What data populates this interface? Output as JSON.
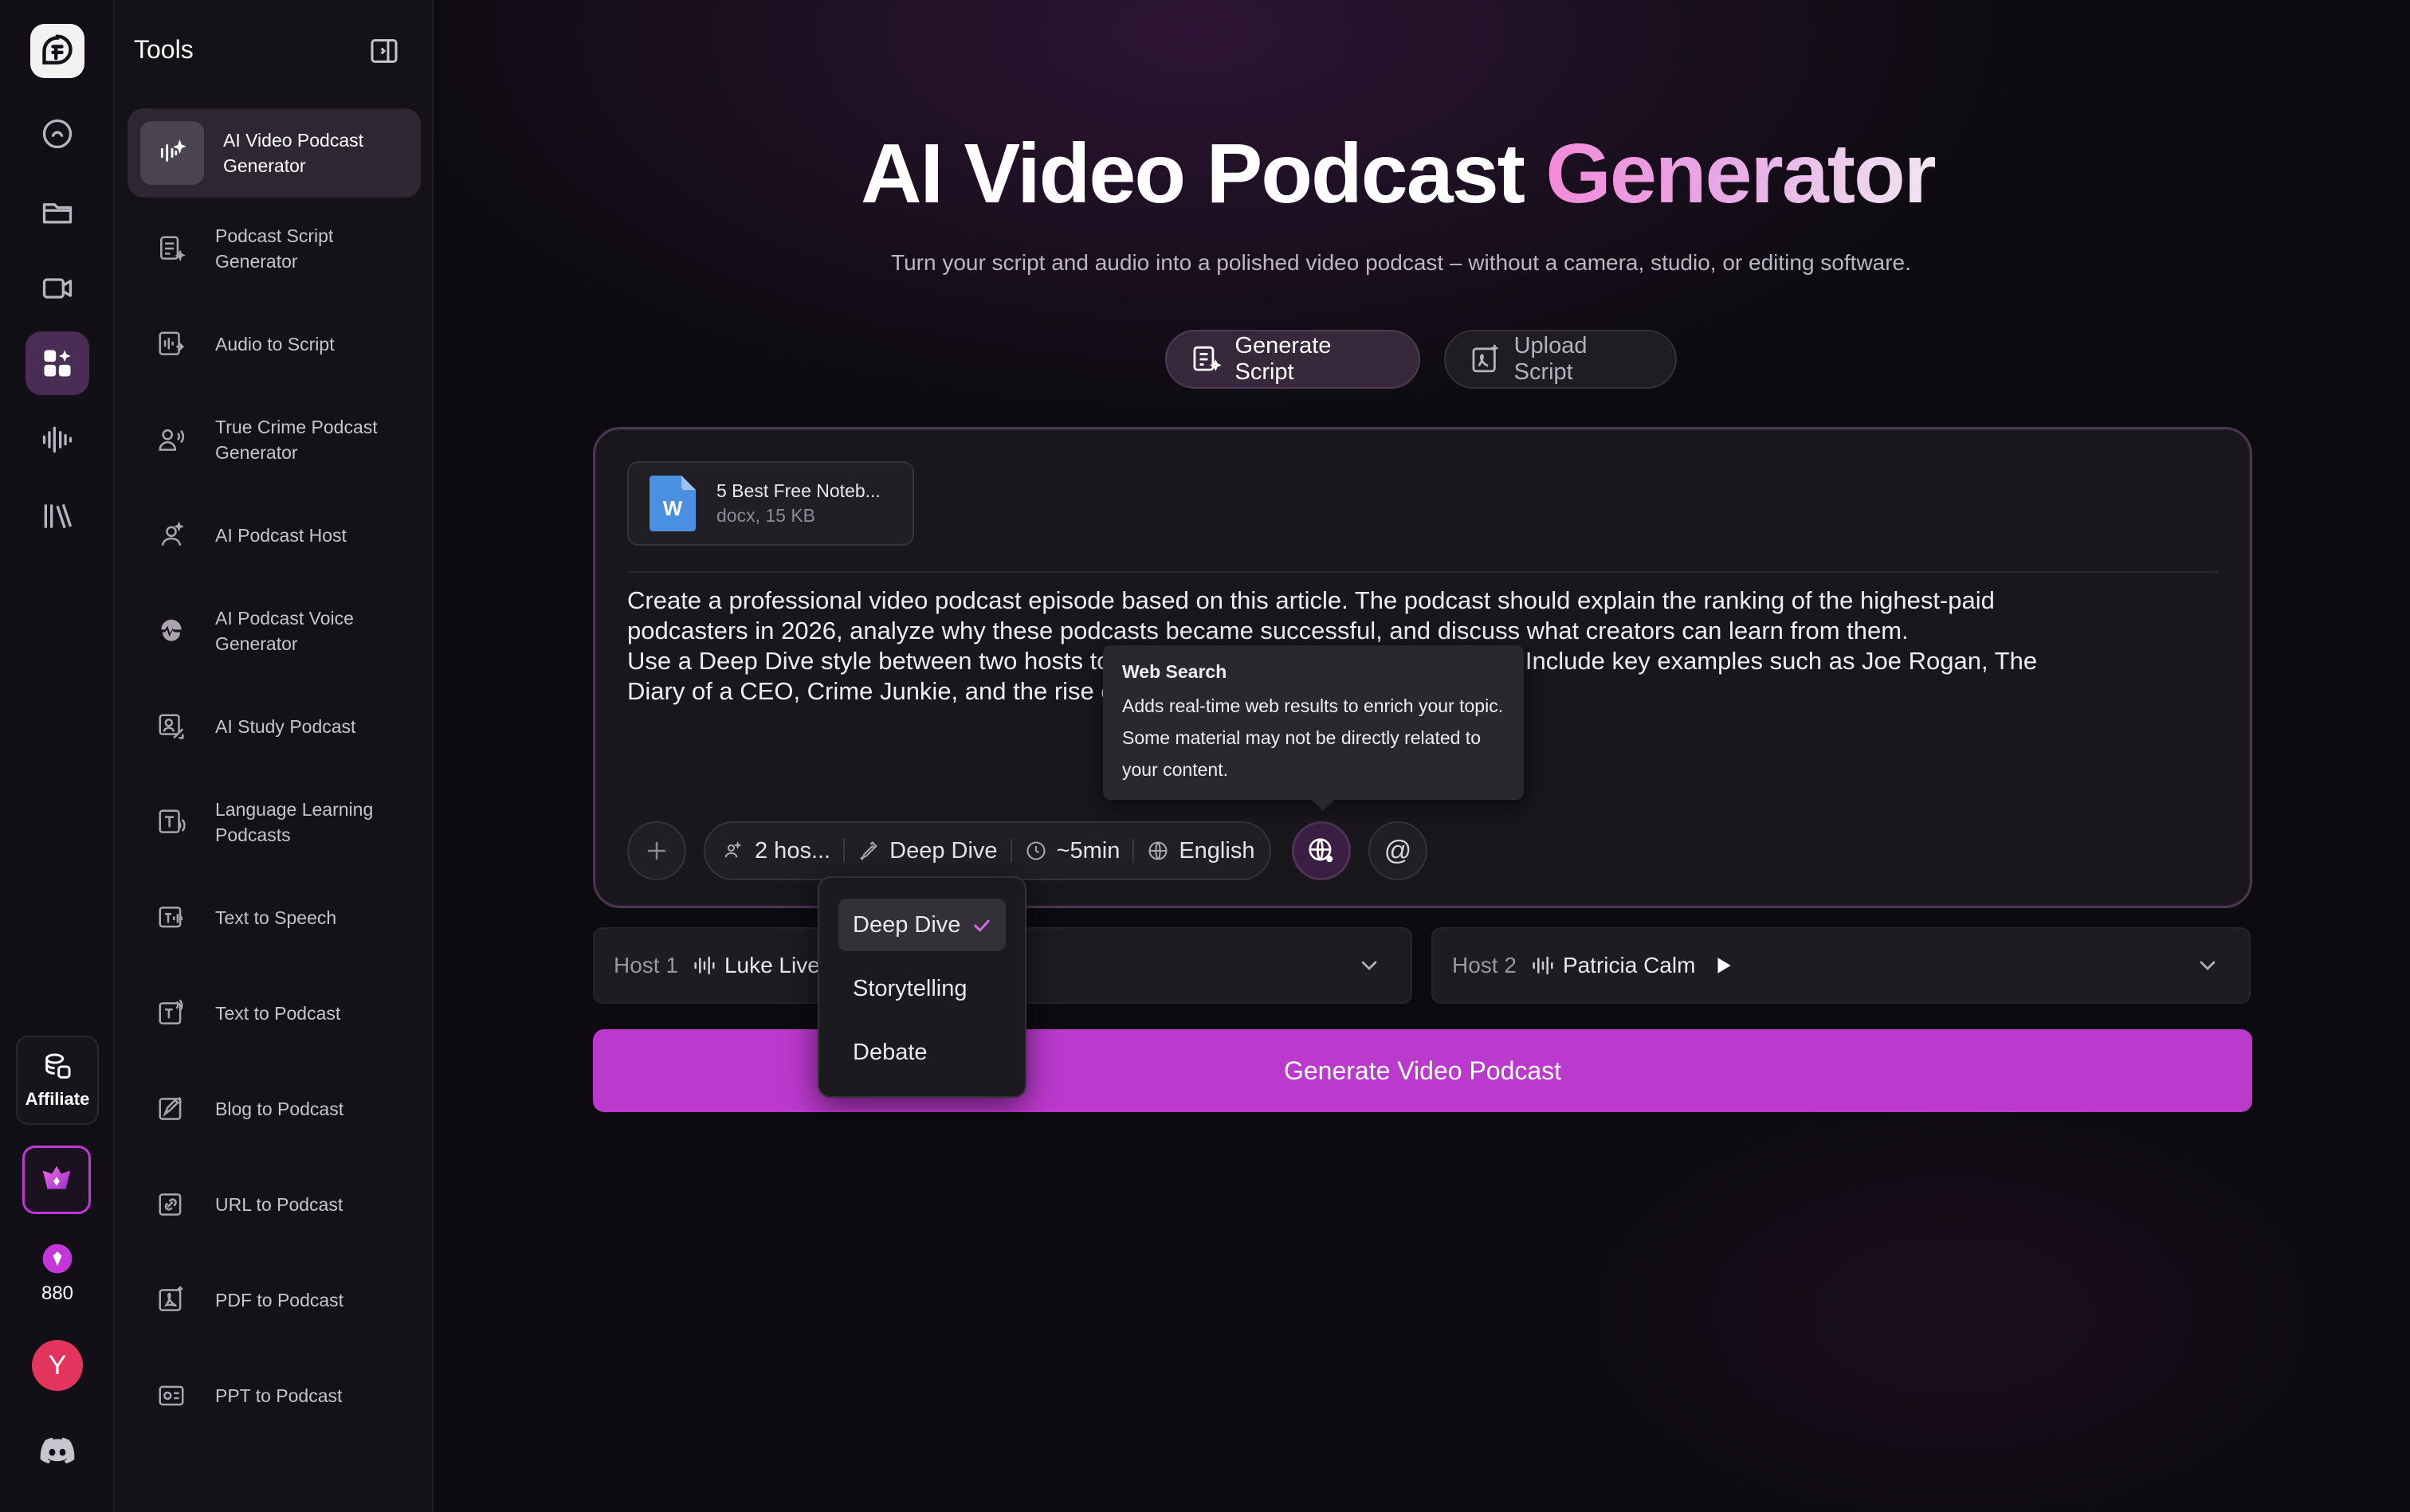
{
  "tools": {
    "title": "Tools",
    "items": [
      {
        "label": "AI Video Podcast Generator",
        "icon": "video-podcast-icon",
        "active": true
      },
      {
        "label": "Podcast Script Generator",
        "icon": "script-icon"
      },
      {
        "label": "Audio to Script",
        "icon": "audio-script-icon"
      },
      {
        "label": "True Crime Podcast Generator",
        "icon": "true-crime-icon"
      },
      {
        "label": "AI Podcast Host",
        "icon": "host-icon"
      },
      {
        "label": "AI Podcast Voice Generator",
        "icon": "voice-icon"
      },
      {
        "label": "AI Study Podcast",
        "icon": "study-icon"
      },
      {
        "label": "Language Learning Podcasts",
        "icon": "language-icon"
      },
      {
        "label": "Text to Speech",
        "icon": "tts-icon"
      },
      {
        "label": "Text to Podcast",
        "icon": "text-podcast-icon"
      },
      {
        "label": "Blog to Podcast",
        "icon": "blog-icon"
      },
      {
        "label": "URL to Podcast",
        "icon": "url-icon"
      },
      {
        "label": "PDF to Podcast",
        "icon": "pdf-icon"
      },
      {
        "label": "PPT to Podcast",
        "icon": "ppt-icon"
      }
    ]
  },
  "rail": {
    "affiliate_label": "Affiliate",
    "credits": "880",
    "avatar_initial": "Y"
  },
  "hero": {
    "title_part1": "AI Video Podcast ",
    "title_part2": "Generator",
    "subtitle": "Turn your script and audio into a polished video podcast – without a camera, studio, or editing software."
  },
  "modes": {
    "generate": "Generate Script",
    "upload": "Upload Script"
  },
  "file": {
    "name": "5 Best Free Noteb...",
    "meta": "docx, 15 KB",
    "type_letter": "W"
  },
  "prompt": {
    "line1": "Create a professional video podcast episode based on this article. The podcast should explain the ranking of the highest-paid",
    "line2": "podcasters in 2026, analyze why these podcasts became successful, and discuss what creators can learn from them.",
    "line3": "Use a Deep Dive style between two hosts to make it feel like an analysis podcast. Include key examples such as Joe Rogan, The",
    "line4": "Diary of a CEO, Crime Junkie, and the rise of video podcasts."
  },
  "settings": {
    "hosts": "2 hos...",
    "style": "Deep Dive",
    "duration": "~5min",
    "language": "English",
    "mention": "@"
  },
  "tooltip": {
    "title": "Web Search",
    "body": "Adds real-time web results to enrich your topic. Some material may not be directly related to your content."
  },
  "hosts": {
    "host1_label": "Host 1",
    "host1_voice": "Luke Lively",
    "host2_label": "Host 2",
    "host2_voice": "Patricia Calm"
  },
  "cta": "Generate Video Podcast",
  "style_dropdown": {
    "options": [
      "Deep Dive",
      "Storytelling",
      "Debate"
    ],
    "selected": "Deep Dive"
  },
  "colors": {
    "accent": "#bb39cd",
    "background": "#0d0b10",
    "avatar": "#e2345c"
  }
}
